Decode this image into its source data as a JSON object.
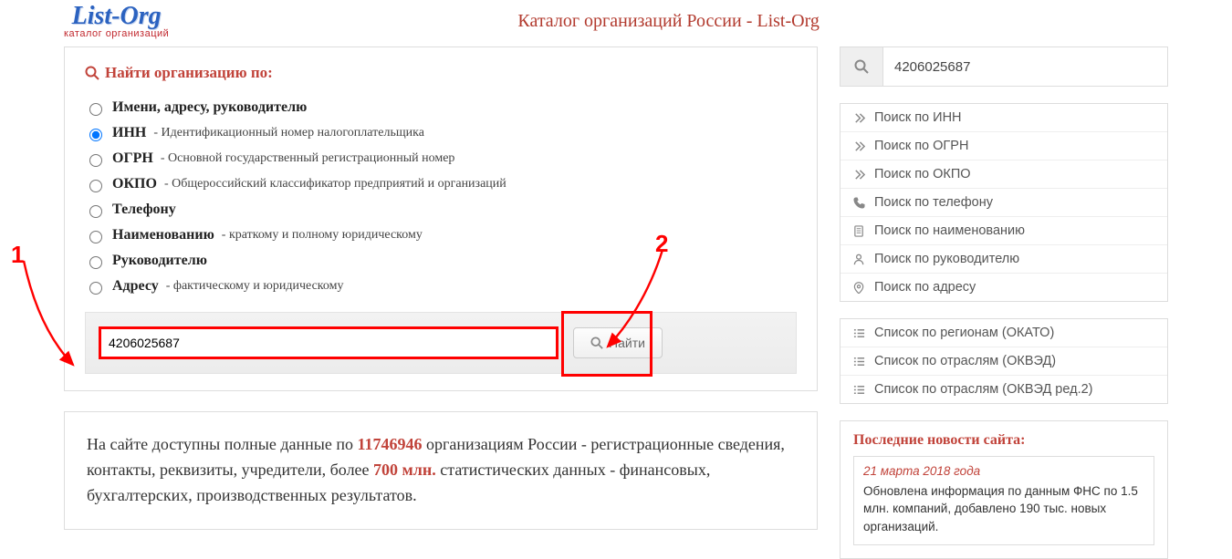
{
  "logo": {
    "main": "List-Org",
    "sub": "каталог организаций"
  },
  "page_title": "Каталог организаций России - List-Org",
  "search_box": {
    "heading": "Найти организацию по:",
    "options": [
      {
        "label": "Имени, адресу, руководителю",
        "hint": "",
        "checked": false
      },
      {
        "label": "ИНН",
        "hint": " - Идентификационный номер налогоплательщика",
        "checked": true
      },
      {
        "label": "ОГРН",
        "hint": " - Основной государственный регистрационный номер",
        "checked": false
      },
      {
        "label": "ОКПО",
        "hint": " - Общероссийский классификатор предприятий и организаций",
        "checked": false
      },
      {
        "label": "Телефону",
        "hint": "",
        "checked": false
      },
      {
        "label": "Наименованию",
        "hint": " - краткому и полному юридическому",
        "checked": false
      },
      {
        "label": "Руководителю",
        "hint": "",
        "checked": false
      },
      {
        "label": "Адресу",
        "hint": " - фактическому и юридическому",
        "checked": false
      }
    ],
    "input_value": "4206025687",
    "find_label": "Найти"
  },
  "info": {
    "t1": "На сайте доступны полные данные по ",
    "num1": "11746946",
    "t2": " организациям России - регистрационные сведения, контакты, реквизиты, учредители, более ",
    "num2": "700 млн.",
    "t3": " статистических данных - финансовых, бухгалтерских, производственных результатов."
  },
  "sidebar": {
    "search_value": "4206025687",
    "links1": [
      {
        "icon": "chev",
        "label": "Поиск по ИНН"
      },
      {
        "icon": "chev",
        "label": "Поиск по ОГРН"
      },
      {
        "icon": "chev",
        "label": "Поиск по ОКПО"
      },
      {
        "icon": "phone",
        "label": "Поиск по телефону"
      },
      {
        "icon": "doc",
        "label": "Поиск по наименованию"
      },
      {
        "icon": "user",
        "label": "Поиск по руководителю"
      },
      {
        "icon": "pin",
        "label": "Поиск по адресу"
      }
    ],
    "links2": [
      {
        "icon": "list",
        "label": "Список по регионам (ОКАТО)"
      },
      {
        "icon": "list",
        "label": "Список по отраслям (ОКВЭД)"
      },
      {
        "icon": "list",
        "label": "Список по отраслям (ОКВЭД ред.2)"
      }
    ]
  },
  "news": {
    "title": "Последние новости сайта:",
    "item": {
      "date": "21 марта 2018 года",
      "body": "Обновлена информация по данным ФНС по 1.5 млн. компаний, добавлено 190 тыс. новых организаций."
    }
  },
  "annotations": {
    "label1": "1",
    "label2": "2"
  }
}
